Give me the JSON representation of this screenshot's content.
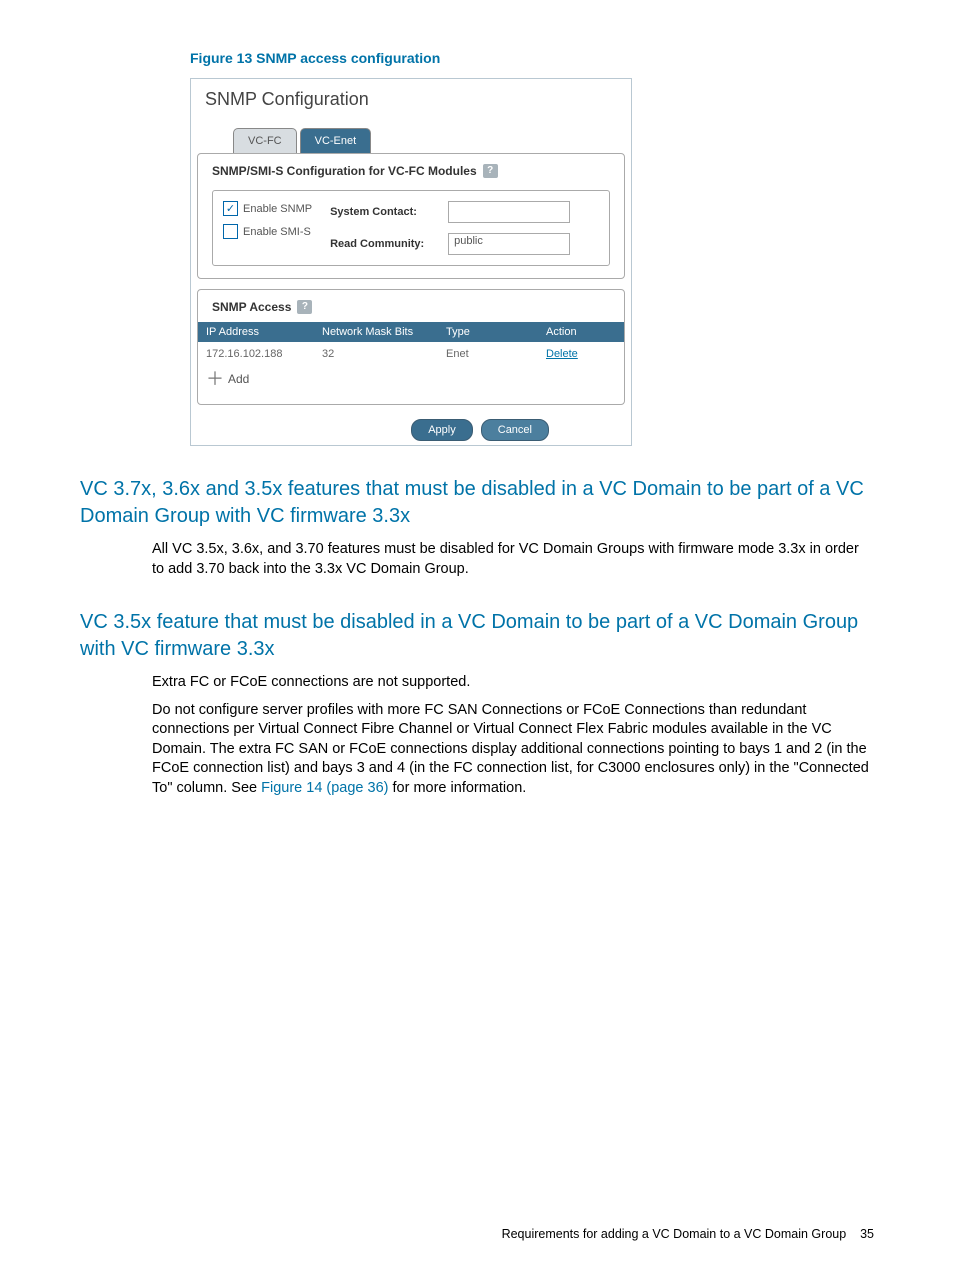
{
  "figure": {
    "caption": "Figure 13 SNMP access configuration"
  },
  "screenshot": {
    "title": "SNMP Configuration",
    "tabs": [
      "VC-FC",
      "VC-Enet"
    ],
    "panel1_heading": "SNMP/SMI-S Configuration for VC-FC Modules",
    "checkboxes": {
      "enable_snmp": {
        "label": "Enable SNMP",
        "checked_glyph": "✓"
      },
      "enable_smis": {
        "label": "Enable SMI-S",
        "checked_glyph": ""
      }
    },
    "fields": {
      "system_contact": {
        "label": "System Contact:",
        "value": ""
      },
      "read_community": {
        "label": "Read Community:",
        "value": "public"
      }
    },
    "access": {
      "heading": "SNMP Access",
      "columns": {
        "ip": "IP Address",
        "mask": "Network Mask Bits",
        "type": "Type",
        "action": "Action"
      },
      "rows": [
        {
          "ip": "172.16.102.188",
          "mask": "32",
          "type": "Enet",
          "action": "Delete"
        }
      ],
      "add_label": "Add"
    },
    "buttons": {
      "apply": "Apply",
      "cancel": "Cancel"
    }
  },
  "sections": {
    "h1": "VC 3.7x, 3.6x and 3.5x features that must be disabled in a VC Domain to be part of a VC Domain Group with VC firmware 3.3x",
    "p1": "All VC 3.5x, 3.6x, and 3.70 features must be disabled for VC Domain Groups with firmware mode 3.3x in order to add 3.70 back into the 3.3x VC Domain Group.",
    "h2": "VC 3.5x feature that must be disabled in a VC Domain to be part of a VC Domain Group with VC firmware 3.3x",
    "p2": "Extra FC or FCoE connections are not supported.",
    "p3a": "Do not configure server profiles with more FC SAN Connections or FCoE Connections than redundant connections per Virtual Connect Fibre Channel or Virtual Connect Flex Fabric modules available in the VC Domain. The extra FC SAN or FCoE connections display additional connections pointing to bays 1 and 2 (in the FCoE connection list) and bays 3 and 4 (in the FC connection list, for C3000 enclosures only) in the \"Connected To\" column. See ",
    "p3_link": "Figure 14 (page 36)",
    "p3b": " for more information."
  },
  "footer": {
    "text": "Requirements for adding a VC Domain to a VC Domain Group",
    "page": "35"
  }
}
